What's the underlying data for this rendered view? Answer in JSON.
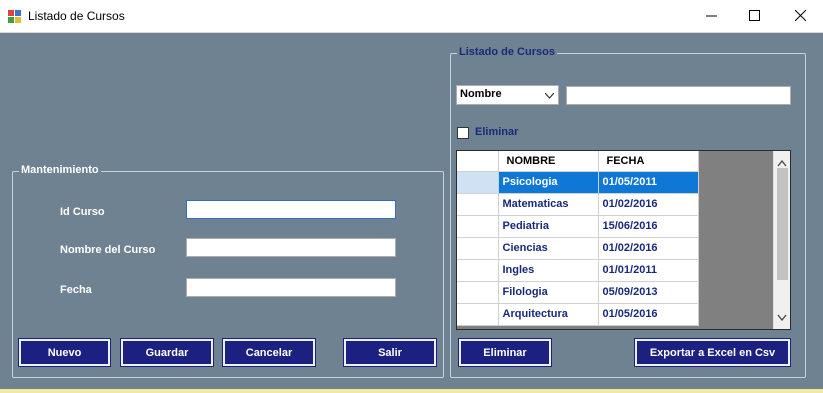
{
  "window": {
    "title": "Listado de Cursos",
    "icon": "windows-forms-icon",
    "controls": [
      "minimize-icon",
      "maximize-icon",
      "close-icon"
    ]
  },
  "maintenance": {
    "legend": "Mantenimiento",
    "id_label": "Id Curso",
    "id_value": "",
    "name_label": "Nombre del Curso",
    "name_value": "",
    "date_label": "Fecha",
    "date_value": "",
    "buttons": {
      "new": "Nuevo",
      "save": "Guardar",
      "cancel": "Cancelar",
      "exit": "Salir"
    }
  },
  "listing": {
    "legend": "Listado de Cursos",
    "filter_field": "Nombre",
    "search_value": "",
    "delete_checkbox_label": "Eliminar",
    "delete_checked": false,
    "columns": [
      "NOMBRE",
      "FECHA"
    ],
    "rows": [
      {
        "name": "Psicologia",
        "date": "01/05/2011",
        "selected": true
      },
      {
        "name": "Matematicas",
        "date": "01/02/2016",
        "selected": false
      },
      {
        "name": "Pediatria",
        "date": "15/06/2016",
        "selected": false
      },
      {
        "name": "Ciencias",
        "date": "01/02/2016",
        "selected": false
      },
      {
        "name": "Ingles",
        "date": "01/01/2011",
        "selected": false
      },
      {
        "name": "Filologia",
        "date": "05/09/2013",
        "selected": false
      },
      {
        "name": "Arquitectura",
        "date": "01/05/2016",
        "selected": false
      }
    ],
    "buttons": {
      "delete": "Eliminar",
      "export": "Exportar a Excel en Csv"
    }
  },
  "colors": {
    "background": "#6e8292",
    "button": "#1c2080",
    "selection": "#0f78d7",
    "label_dark": "#1a2a7a"
  }
}
